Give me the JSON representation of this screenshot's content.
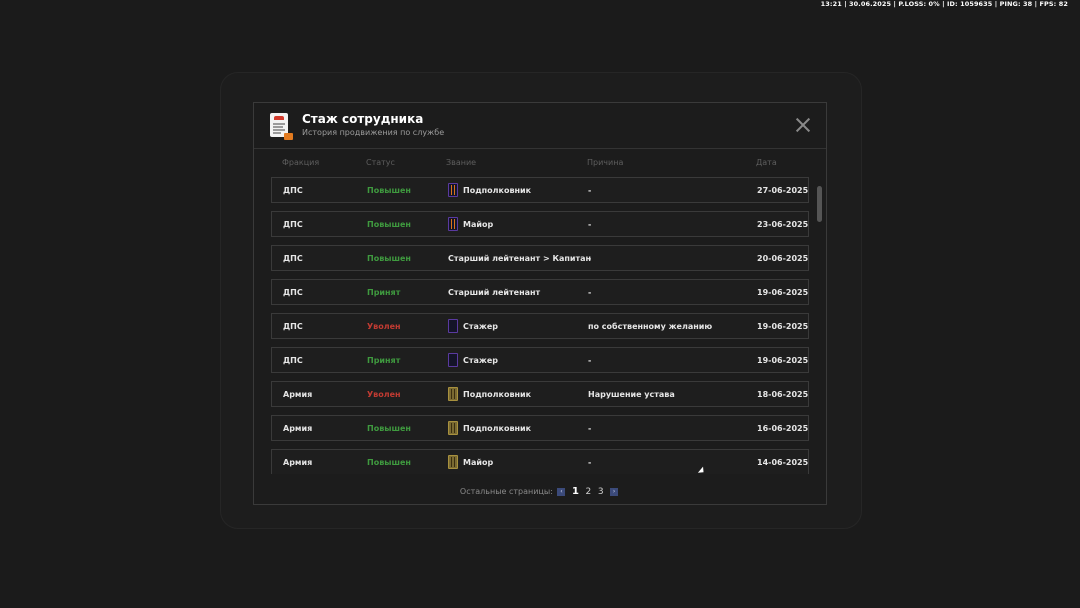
{
  "hud": "13:21 | 30.06.2025 | P.LOSS: 0% | ID: 1059635 | PING: 38 | FPS: 82",
  "modal": {
    "title": "Стаж сотрудника",
    "subtitle": "История продвижения по службе"
  },
  "columns": {
    "faction": "Фракция",
    "status": "Статус",
    "rank": "Звание",
    "reason": "Причина",
    "date": "Дата"
  },
  "rows": [
    {
      "faction": "ДПС",
      "status": "Повышен",
      "status_type": "up",
      "rank": "Подполковник",
      "rank_icon": "dps-epaulette-icon",
      "reason": "-",
      "date": "27-06-2025"
    },
    {
      "faction": "ДПС",
      "status": "Повышен",
      "status_type": "up",
      "rank": "Майор",
      "rank_icon": "dps-epaulette-icon",
      "reason": "-",
      "date": "23-06-2025"
    },
    {
      "faction": "ДПС",
      "status": "Повышен",
      "status_type": "up",
      "rank": "Старший лейтенант > Капитан",
      "rank_icon": "",
      "reason": "-",
      "date": "20-06-2025"
    },
    {
      "faction": "ДПС",
      "status": "Принят",
      "status_type": "ok",
      "rank": "Старший лейтенант",
      "rank_icon": "",
      "reason": "-",
      "date": "19-06-2025"
    },
    {
      "faction": "ДПС",
      "status": "Уволен",
      "status_type": "out",
      "rank": "Стажер",
      "rank_icon": "plain-epaulette-icon",
      "reason": "по собственному желанию",
      "date": "19-06-2025"
    },
    {
      "faction": "ДПС",
      "status": "Принят",
      "status_type": "ok",
      "rank": "Стажер",
      "rank_icon": "plain-epaulette-icon",
      "reason": "-",
      "date": "19-06-2025"
    },
    {
      "faction": "Армия",
      "status": "Уволен",
      "status_type": "out",
      "rank": "Подполковник",
      "rank_icon": "army-epaulette-icon",
      "reason": "Нарушение устава",
      "date": "18-06-2025"
    },
    {
      "faction": "Армия",
      "status": "Повышен",
      "status_type": "up",
      "rank": "Подполковник",
      "rank_icon": "army-epaulette-icon",
      "reason": "-",
      "date": "16-06-2025"
    },
    {
      "faction": "Армия",
      "status": "Повышен",
      "status_type": "up",
      "rank": "Майор",
      "rank_icon": "army-epaulette-icon",
      "reason": "-",
      "date": "14-06-2025"
    }
  ],
  "pager": {
    "label": "Остальные страницы:",
    "pages": [
      "1",
      "2",
      "3"
    ],
    "active": "1",
    "prev": "‹",
    "next": "›"
  },
  "colors": {
    "status_up": "#3f9a3f",
    "status_out": "#c23b32",
    "background": "#1b1b1b"
  }
}
